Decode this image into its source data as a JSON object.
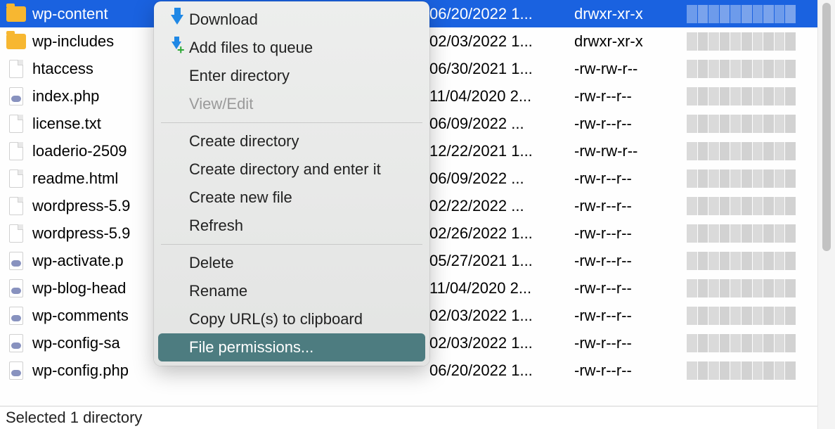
{
  "files": [
    {
      "name": "wp-content",
      "date": "06/20/2022 1...",
      "perm": "drwxr-xr-x",
      "type": "folder",
      "selected": true
    },
    {
      "name": "wp-includes",
      "date": "02/03/2022 1...",
      "perm": "drwxr-xr-x",
      "type": "folder"
    },
    {
      "name": "htaccess",
      "date": "06/30/2021 1...",
      "perm": "-rw-rw-r--",
      "type": "file"
    },
    {
      "name": "index.php",
      "date": "11/04/2020 2...",
      "perm": "-rw-r--r--",
      "type": "php"
    },
    {
      "name": "license.txt",
      "date": "06/09/2022 ...",
      "perm": "-rw-r--r--",
      "type": "file"
    },
    {
      "name": "loaderio-2509",
      "date": "12/22/2021 1...",
      "perm": "-rw-rw-r--",
      "type": "file"
    },
    {
      "name": "readme.html",
      "date": "06/09/2022 ...",
      "perm": "-rw-r--r--",
      "type": "file"
    },
    {
      "name": "wordpress-5.9",
      "date": "02/22/2022 ...",
      "perm": "-rw-r--r--",
      "type": "file"
    },
    {
      "name": "wordpress-5.9",
      "date": "02/26/2022 1...",
      "perm": "-rw-r--r--",
      "type": "file"
    },
    {
      "name": "wp-activate.p",
      "date": "05/27/2021 1...",
      "perm": "-rw-r--r--",
      "type": "php"
    },
    {
      "name": "wp-blog-head",
      "date": "11/04/2020 2...",
      "perm": "-rw-r--r--",
      "type": "php"
    },
    {
      "name": "wp-comments",
      "date": "02/03/2022 1...",
      "perm": "-rw-r--r--",
      "type": "php"
    },
    {
      "name": "wp-config-sa",
      "date": "02/03/2022 1...",
      "perm": "-rw-r--r--",
      "type": "php"
    },
    {
      "name": "wp-config.php",
      "date": "06/20/2022 1...",
      "perm": "-rw-r--r--",
      "type": "php"
    }
  ],
  "context_menu": {
    "download": "Download",
    "add_to_queue": "Add files to queue",
    "enter_directory": "Enter directory",
    "view_edit": "View/Edit",
    "create_directory": "Create directory",
    "create_directory_enter": "Create directory and enter it",
    "create_new_file": "Create new file",
    "refresh": "Refresh",
    "delete": "Delete",
    "rename": "Rename",
    "copy_url": "Copy URL(s) to clipboard",
    "file_permissions": "File permissions..."
  },
  "status": "Selected 1 directory"
}
